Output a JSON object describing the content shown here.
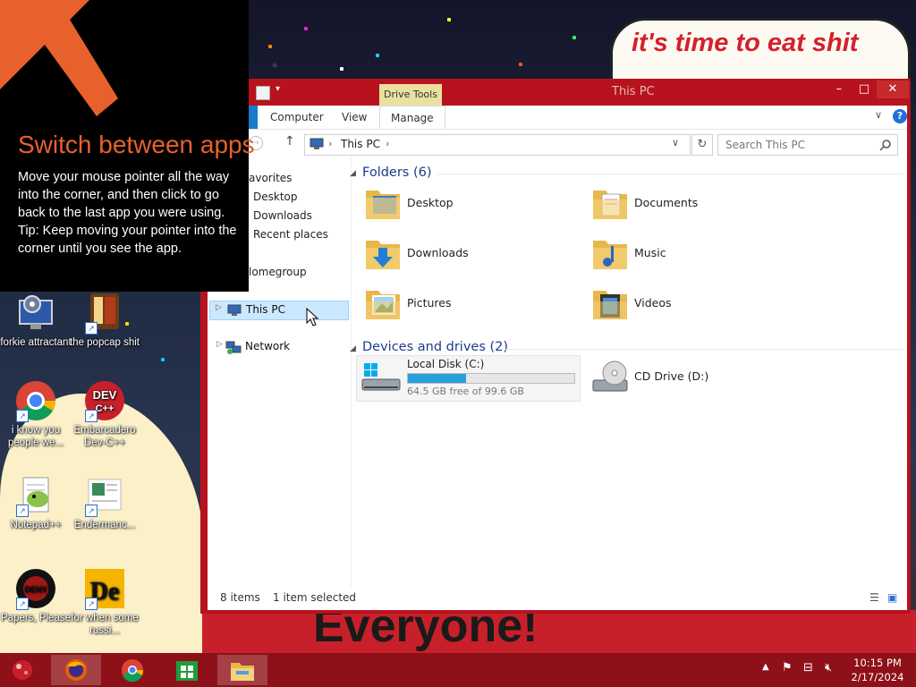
{
  "wallpaper": {
    "speech_text": "it's time to eat shit",
    "banner_text": "Everyone!"
  },
  "tip": {
    "title": "Switch between apps",
    "body": "Move your mouse pointer all the way into the corner, and then click to go back to the last app you were using.",
    "hint": "Tip: Keep moving your pointer into the corner until you see the app."
  },
  "desktop_icons": [
    {
      "label": "forkie attractant",
      "icon": "settings-app-icon"
    },
    {
      "label": "the popcap shit",
      "icon": "game-icon"
    },
    {
      "label": "i know you people we...",
      "icon": "chrome-icon"
    },
    {
      "label": "Embarcadero Dev-C++",
      "icon": "devcpp-icon"
    },
    {
      "label": "Notepad++",
      "icon": "notepadpp-icon"
    },
    {
      "label": "Endermanc...",
      "icon": "document-icon"
    },
    {
      "label": "Papers, Please",
      "icon": "papers-please-icon"
    },
    {
      "label": "for when some russi...",
      "icon": "de-app-icon"
    }
  ],
  "explorer": {
    "title": "This PC",
    "contextual_tab": "Drive Tools",
    "ribbon_tabs": [
      "Computer",
      "View",
      "Manage"
    ],
    "address": "This PC",
    "search_placeholder": "Search This PC",
    "nav": {
      "favorites": "avorites",
      "favorite_items": [
        "Desktop",
        "Downloads",
        "Recent places"
      ],
      "homegroup": "lomegroup",
      "this_pc": "This PC",
      "network": "Network"
    },
    "folders_header": "Folders (6)",
    "folders": [
      "Desktop",
      "Documents",
      "Downloads",
      "Music",
      "Pictures",
      "Videos"
    ],
    "devices_header": "Devices and drives (2)",
    "drives": [
      {
        "name": "Local Disk (C:)",
        "free_text": "64.5 GB free of 99.6 GB",
        "used_fraction": 0.352
      },
      {
        "name": "CD Drive (D:)"
      }
    ],
    "status_items": "8 items",
    "status_selected": "1 item selected"
  },
  "taskbar": {
    "time": "10:15 PM",
    "date": "2/17/2024",
    "apps": [
      "firefox-icon",
      "chrome-icon",
      "store-icon",
      "file-explorer-icon"
    ]
  },
  "colors": {
    "window_frame": "#b8121e",
    "taskbar": "#8e1018",
    "accent_orange": "#e8612c",
    "link_blue": "#1e3a8a",
    "progress_blue": "#26a0da"
  }
}
